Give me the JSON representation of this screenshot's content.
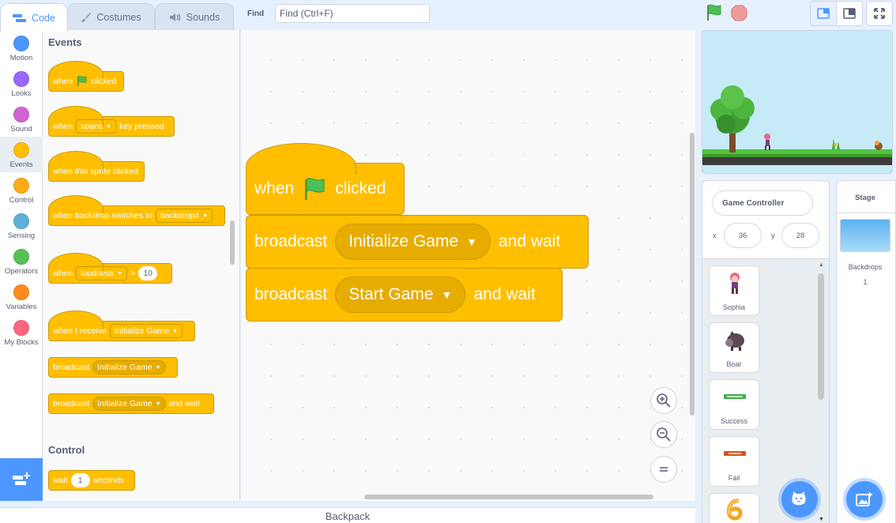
{
  "tabs": [
    {
      "label": "Code",
      "icon": "code-icon",
      "active": true
    },
    {
      "label": "Costumes",
      "icon": "brush-icon",
      "active": false
    },
    {
      "label": "Sounds",
      "icon": "speaker-icon",
      "active": false
    }
  ],
  "find": {
    "label": "Find",
    "placeholder": "Find (Ctrl+F)"
  },
  "categories": [
    {
      "label": "Motion",
      "color": "#4c97ff"
    },
    {
      "label": "Looks",
      "color": "#9966ff"
    },
    {
      "label": "Sound",
      "color": "#cf63cf"
    },
    {
      "label": "Events",
      "color": "#ffbf00"
    },
    {
      "label": "Control",
      "color": "#ffab19"
    },
    {
      "label": "Sensing",
      "color": "#5cb1d6"
    },
    {
      "label": "Operators",
      "color": "#59c059"
    },
    {
      "label": "Variables",
      "color": "#ff8c1a"
    },
    {
      "label": "My Blocks",
      "color": "#ff6680"
    }
  ],
  "palette": {
    "events_heading": "Events",
    "control_heading": "Control",
    "when_flag": {
      "pre": "when",
      "post": "clicked"
    },
    "when_key": {
      "pre": "when",
      "key": "space",
      "post": "key pressed"
    },
    "when_sprite": {
      "text": "when this sprite clicked"
    },
    "when_backdrop": {
      "pre": "when backdrop switches to",
      "value": "backdrop4"
    },
    "when_loudness": {
      "pre": "when",
      "value": "loudness",
      "op": ">",
      "num": "10"
    },
    "when_receive": {
      "pre": "when I receive",
      "value": "Initialize Game"
    },
    "broadcast": {
      "pre": "broadcast",
      "value": "Initialize Game"
    },
    "broadcast_wait": {
      "pre": "broadcast",
      "value": "Initialize Game",
      "post": "and wait"
    },
    "wait": {
      "pre": "wait",
      "num": "1",
      "post": "seconds"
    }
  },
  "script": {
    "hat": {
      "pre": "when",
      "post": "clicked"
    },
    "block1": {
      "pre": "broadcast",
      "value": "Initialize Game",
      "post": "and wait"
    },
    "block2": {
      "pre": "broadcast",
      "value": "Start Game",
      "post": "and wait"
    }
  },
  "backpack_label": "Backpack",
  "sprite_info": {
    "name": "Game Controller",
    "x_label": "x",
    "x": "36",
    "y_label": "y",
    "y": "28"
  },
  "sprites": [
    {
      "name": "Sophia"
    },
    {
      "name": "Boar"
    },
    {
      "name": "Success"
    },
    {
      "name": "Fail"
    },
    {
      "name": ""
    }
  ],
  "stage_pane": {
    "title": "Stage",
    "backdrops_label": "Backdrops",
    "backdrops_count": "1"
  },
  "colors": {
    "events": "#ffbf00",
    "events_border": "#cc9900",
    "accent": "#4c97ff"
  }
}
